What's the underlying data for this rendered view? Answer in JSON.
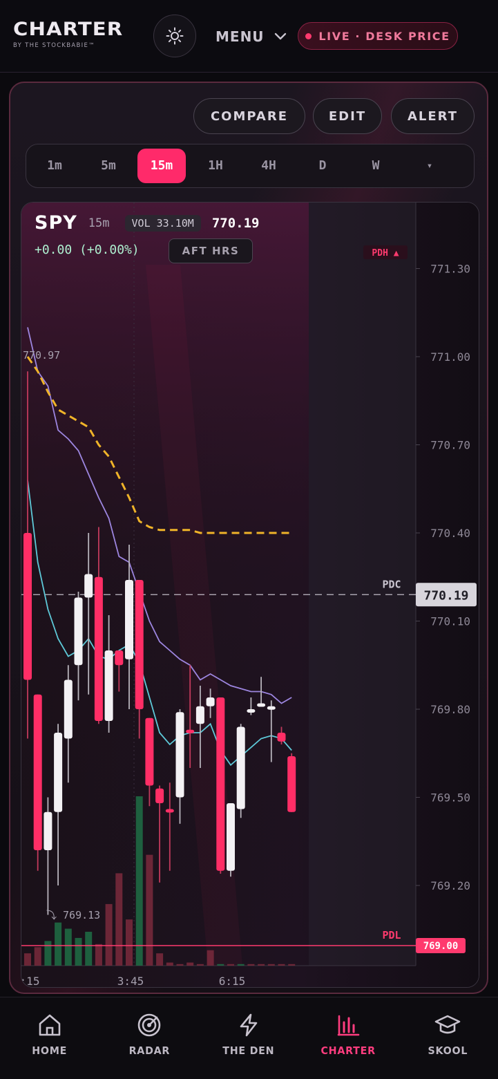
{
  "header": {
    "brand_name": "CHARTER",
    "brand_tagline": "BY THE STOCKBABIE™",
    "menu_label": "MENU",
    "live_label": "LIVE · DESK PRICE",
    "accent_color": "#ff2a6a"
  },
  "toolbar": {
    "compare_label": "COMPARE",
    "edit_label": "EDIT",
    "alert_label": "ALERT"
  },
  "timeframes": {
    "items": [
      "1m",
      "5m",
      "15m",
      "1H",
      "4H",
      "D",
      "W"
    ],
    "active": "15m",
    "more_label": "▾"
  },
  "chart_header": {
    "symbol": "SPY",
    "timeframe": "15m",
    "volume": "VOL 33.10M",
    "last_price": "770.19",
    "change": "+0.00 (+0.00%)",
    "after_hours_label": "AFT HRS"
  },
  "chart_data": {
    "type": "candlestick",
    "ylim": [
      769.0,
      771.4
    ],
    "y_ticks": [
      "771.30",
      "771.00",
      "770.70",
      "770.40",
      "770.10",
      "769.80",
      "769.50",
      "769.20"
    ],
    "x_tick_labels": [
      ":15",
      "3:45",
      "6:15"
    ],
    "candles": [
      {
        "o": 770.4,
        "h": 770.95,
        "l": 769.7,
        "c": 769.9
      },
      {
        "o": 769.85,
        "h": 769.85,
        "l": 769.25,
        "c": 769.32
      },
      {
        "o": 769.32,
        "h": 769.5,
        "l": 769.1,
        "c": 769.45
      },
      {
        "o": 769.45,
        "h": 769.75,
        "l": 769.2,
        "c": 769.72
      },
      {
        "o": 769.7,
        "h": 769.95,
        "l": 769.55,
        "c": 769.9
      },
      {
        "o": 769.95,
        "h": 770.2,
        "l": 769.83,
        "c": 770.18
      },
      {
        "o": 770.18,
        "h": 770.4,
        "l": 769.85,
        "c": 770.26
      },
      {
        "o": 770.25,
        "h": 770.42,
        "l": 769.75,
        "c": 769.76
      },
      {
        "o": 769.76,
        "h": 770.12,
        "l": 769.72,
        "c": 770.0
      },
      {
        "o": 770.0,
        "h": 770.0,
        "l": 769.86,
        "c": 769.95
      },
      {
        "o": 769.97,
        "h": 770.36,
        "l": 769.8,
        "c": 770.24
      },
      {
        "o": 770.24,
        "h": 770.24,
        "l": 769.7,
        "c": 769.8
      },
      {
        "o": 769.77,
        "h": 769.77,
        "l": 769.47,
        "c": 769.54
      },
      {
        "o": 769.53,
        "h": 769.54,
        "l": 769.21,
        "c": 769.48
      },
      {
        "o": 769.46,
        "h": 769.55,
        "l": 769.25,
        "c": 769.45
      },
      {
        "o": 769.5,
        "h": 769.8,
        "l": 769.41,
        "c": 769.79
      },
      {
        "o": 769.73,
        "h": 769.95,
        "l": 769.6,
        "c": 769.72
      },
      {
        "o": 769.75,
        "h": 769.88,
        "l": 769.6,
        "c": 769.81
      },
      {
        "o": 769.81,
        "h": 769.87,
        "l": 769.77,
        "c": 769.84
      },
      {
        "o": 769.84,
        "h": 769.84,
        "l": 769.24,
        "c": 769.25
      },
      {
        "o": 769.25,
        "h": 769.48,
        "l": 769.23,
        "c": 769.48
      },
      {
        "o": 769.46,
        "h": 769.75,
        "l": 769.43,
        "c": 769.74
      },
      {
        "o": 769.8,
        "h": 769.84,
        "l": 769.78,
        "c": 769.8
      },
      {
        "o": 769.82,
        "h": 769.91,
        "l": 769.82,
        "c": 769.82
      },
      {
        "o": 769.8,
        "h": 769.83,
        "l": 769.62,
        "c": 769.81
      },
      {
        "o": 769.72,
        "h": 769.74,
        "l": 769.68,
        "c": 769.69
      },
      {
        "o": 769.64,
        "h": 769.65,
        "l": 769.45,
        "c": 769.45
      }
    ],
    "volume": [
      8,
      12,
      16,
      28,
      24,
      18,
      22,
      14,
      40,
      60,
      30,
      110,
      72,
      8,
      2,
      1,
      2,
      1,
      10,
      1,
      1,
      1,
      1,
      1,
      1,
      1,
      1
    ],
    "volume_up": [
      false,
      false,
      true,
      true,
      true,
      true,
      true,
      false,
      false,
      false,
      false,
      true,
      false,
      false,
      false,
      false,
      false,
      false,
      false,
      true,
      false,
      true,
      false,
      false,
      false,
      false,
      false
    ],
    "vwap": [
      771.1,
      770.95,
      770.9,
      770.75,
      770.72,
      770.68,
      770.6,
      770.52,
      770.45,
      770.32,
      770.3,
      770.2,
      770.1,
      770.03,
      770.0,
      769.97,
      769.95,
      769.9,
      769.92,
      769.9,
      769.88,
      769.87,
      769.86,
      769.86,
      769.85,
      769.82,
      769.84
    ],
    "ema": [
      770.58,
      770.3,
      770.14,
      770.04,
      769.98,
      770.0,
      770.04,
      769.98,
      769.97,
      770.0,
      770.02,
      769.96,
      769.84,
      769.72,
      769.68,
      769.71,
      769.72,
      769.72,
      769.75,
      769.66,
      769.61,
      769.64,
      769.67,
      769.7,
      769.71,
      769.7,
      769.66
    ],
    "avg_line": [
      771.0,
      770.95,
      770.88,
      770.82,
      770.8,
      770.78,
      770.76,
      770.7,
      770.66,
      770.59,
      770.52,
      770.44,
      770.42,
      770.41,
      770.41,
      770.41,
      770.41,
      770.4,
      770.4,
      770.4,
      770.4,
      770.4,
      770.4,
      770.4,
      770.4,
      770.4,
      770.4
    ],
    "levels": {
      "pdc": {
        "label": "PDC",
        "value": 770.19,
        "badge": "770.19"
      },
      "pdl": {
        "label": "PDL",
        "value": 769.0,
        "badge": "769.00"
      },
      "pdh": {
        "label": "PDH ▲"
      }
    },
    "annotations": {
      "high_label": "770.97",
      "low_label": "⤵ 769.13",
      "high_value": 770.97,
      "low_value": 769.13
    },
    "colors": {
      "up": "#f3f1f4",
      "down": "#ff2e66",
      "vwap": "#9d86e0",
      "ema": "#5ec9d8",
      "avg": "#f0b429",
      "vol_up": "#1f6e45",
      "vol_down": "#7a2a3c"
    }
  },
  "bottom_nav": {
    "items": [
      {
        "label": "HOME",
        "icon": "home-icon"
      },
      {
        "label": "RADAR",
        "icon": "radar-icon"
      },
      {
        "label": "THE DEN",
        "icon": "bolt-icon"
      },
      {
        "label": "CHARTER",
        "icon": "bar-chart-icon"
      },
      {
        "label": "SKOOL",
        "icon": "graduation-cap-icon"
      }
    ],
    "active": "CHARTER"
  }
}
